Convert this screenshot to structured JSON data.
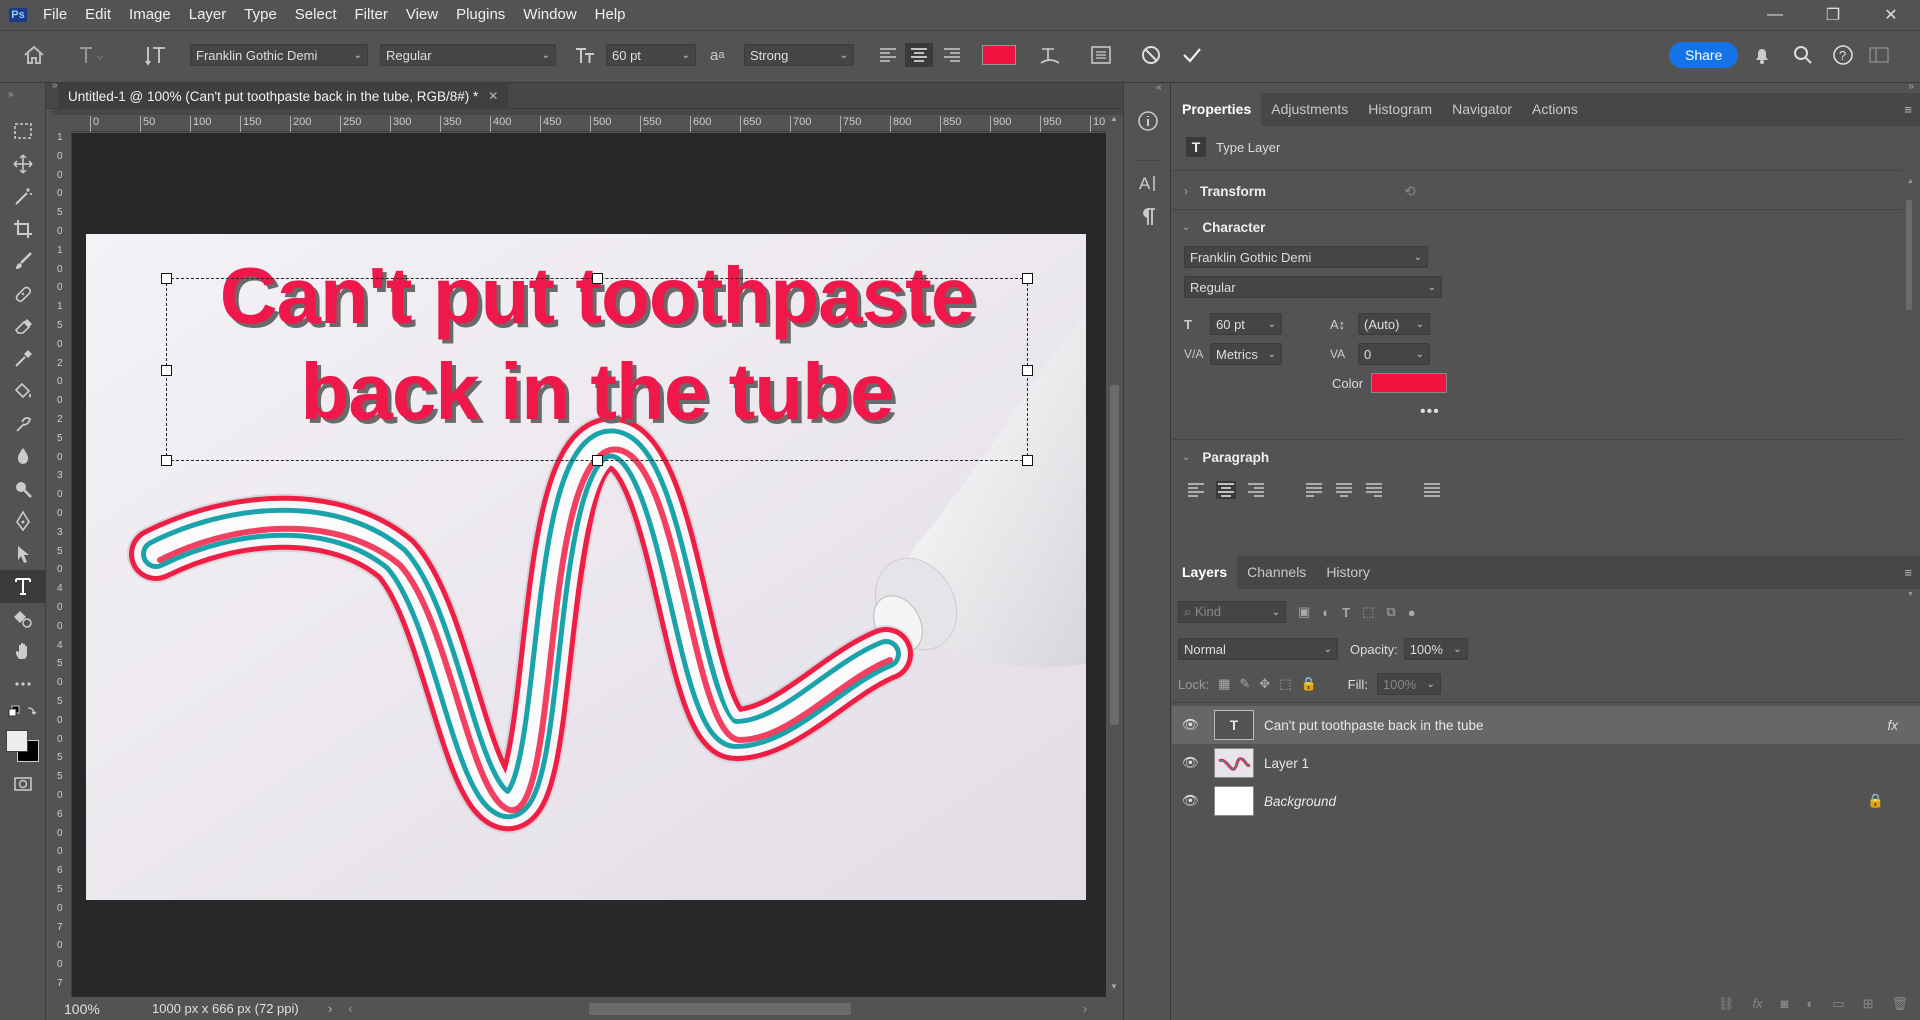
{
  "app": {
    "logo": "Ps"
  },
  "menu": [
    "File",
    "Edit",
    "Image",
    "Layer",
    "Type",
    "Select",
    "Filter",
    "View",
    "Plugins",
    "Window",
    "Help"
  ],
  "window_controls": {
    "minimize": "—",
    "restore": "❐",
    "close": "✕"
  },
  "options": {
    "font_family": "Franklin Gothic Demi",
    "font_style": "Regular",
    "font_size": "60 pt",
    "antialias": "Strong",
    "share": "Share",
    "text_color": "#f0133f"
  },
  "document": {
    "tab_title": "Untitled-1 @ 100% (Can't put toothpaste  back in the tube, RGB/8#) *",
    "text_line1": "Can't put toothpaste",
    "text_line2": "back in the tube",
    "zoom": "100%",
    "doc_info": "1000 px x 666 px (72 ppi)"
  },
  "ruler_h": [
    "0",
    "50",
    "100",
    "150",
    "200",
    "250",
    "300",
    "350",
    "400",
    "450",
    "500",
    "550",
    "600",
    "650",
    "700",
    "750",
    "800",
    "850",
    "900",
    "950",
    "10"
  ],
  "ruler_v": [
    "1",
    "0",
    "0",
    "0",
    "5",
    "0",
    "1",
    "0",
    "0",
    "1",
    "5",
    "0",
    "2",
    "0",
    "0",
    "2",
    "5",
    "0",
    "3",
    "0",
    "0",
    "3",
    "5",
    "0",
    "4",
    "0",
    "0",
    "4",
    "5",
    "0",
    "5",
    "0",
    "0",
    "5",
    "5",
    "0",
    "6",
    "0",
    "0",
    "6",
    "5",
    "0",
    "7",
    "0",
    "0",
    "7"
  ],
  "properties": {
    "tabs": [
      "Properties",
      "Adjustments",
      "Histogram",
      "Navigator",
      "Actions"
    ],
    "layer_kind": "Type Layer",
    "transform": "Transform",
    "character": "Character",
    "font": "Franklin Gothic Demi",
    "style": "Regular",
    "size": "60 pt",
    "leading": "(Auto)",
    "kerning": "Metrics",
    "tracking": "0",
    "color_label": "Color",
    "paragraph": "Paragraph"
  },
  "layers": {
    "tabs": [
      "Layers",
      "Channels",
      "History"
    ],
    "kind_placeholder": "Kind",
    "blend": "Normal",
    "opacity_label": "Opacity:",
    "opacity": "100%",
    "lock_label": "Lock:",
    "fill_label": "Fill:",
    "fill": "100%",
    "items": [
      {
        "name": "Can't put toothpaste  back in the tube"
      },
      {
        "name": "Layer 1"
      },
      {
        "name": "Background"
      }
    ]
  }
}
